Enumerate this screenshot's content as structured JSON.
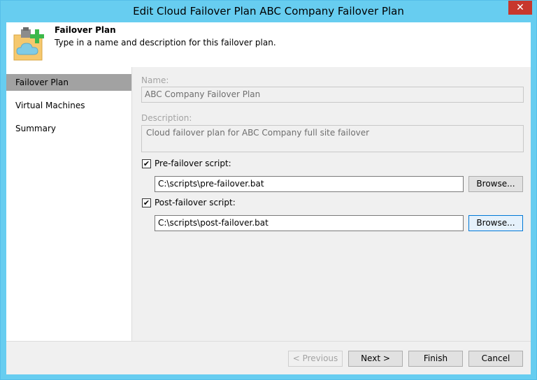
{
  "window": {
    "title": "Edit Cloud Failover Plan ABC Company Failover Plan",
    "close_glyph": "✕"
  },
  "header": {
    "title": "Failover Plan",
    "subtitle": "Type in a name and description for this failover plan."
  },
  "nav": {
    "items": [
      "Failover Plan",
      "Virtual Machines",
      "Summary"
    ],
    "active_index": 0
  },
  "form": {
    "name_label": "Name:",
    "name_value": "ABC Company Failover Plan",
    "description_label": "Description:",
    "description_value": "Cloud failover plan for ABC Company full site failover",
    "pre_script": {
      "label": "Pre-failover script:",
      "checked": true,
      "check_glyph": "✔",
      "value": "C:\\scripts\\pre-failover.bat",
      "browse_label": "Browse..."
    },
    "post_script": {
      "label": "Post-failover script:",
      "checked": true,
      "check_glyph": "✔",
      "value": "C:\\scripts\\post-failover.bat",
      "browse_label": "Browse..."
    }
  },
  "footer": {
    "previous_label": "< Previous",
    "next_label": "Next >",
    "finish_label": "Finish",
    "cancel_label": "Cancel"
  },
  "colors": {
    "titlebar": "#67cdf0",
    "close": "#c7372d",
    "nav_active": "#a2a2a2",
    "icon_plus": "#3cb84a",
    "icon_cloud": "#7fcbe6",
    "icon_folder": "#f5c86e"
  }
}
